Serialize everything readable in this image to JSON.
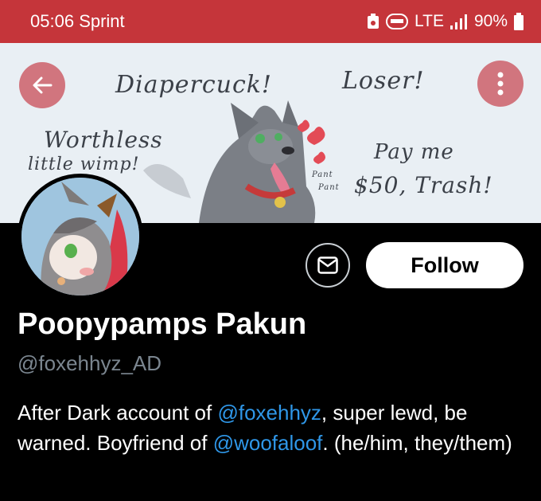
{
  "status_bar": {
    "time": "05:06",
    "carrier": "Sprint",
    "network": "LTE",
    "battery": "90%"
  },
  "banner": {
    "texts": [
      "Diapercuck!",
      "Loser!",
      "Worthless",
      "little wimp!",
      "Pay me",
      "$50, Trash!",
      "Pant",
      "Pant"
    ]
  },
  "header_actions": {
    "back_icon": "arrow-left-icon",
    "more_icon": "more-vertical-icon"
  },
  "profile": {
    "display_name": "Poopypamps Pakun",
    "handle": "@foxehhyz_AD",
    "follow_label": "Follow",
    "message_icon": "mail-icon",
    "bio": {
      "part1": "After Dark account of ",
      "mention1": "@foxehhyz",
      "part2": ", super lewd, be warned. Boyfriend of ",
      "mention2": "@woofaloof",
      "part3": ". (he/him, they/them)"
    }
  },
  "colors": {
    "status_bar": "#c5353a",
    "mention": "#2f97e8",
    "handle": "#7b8690"
  }
}
